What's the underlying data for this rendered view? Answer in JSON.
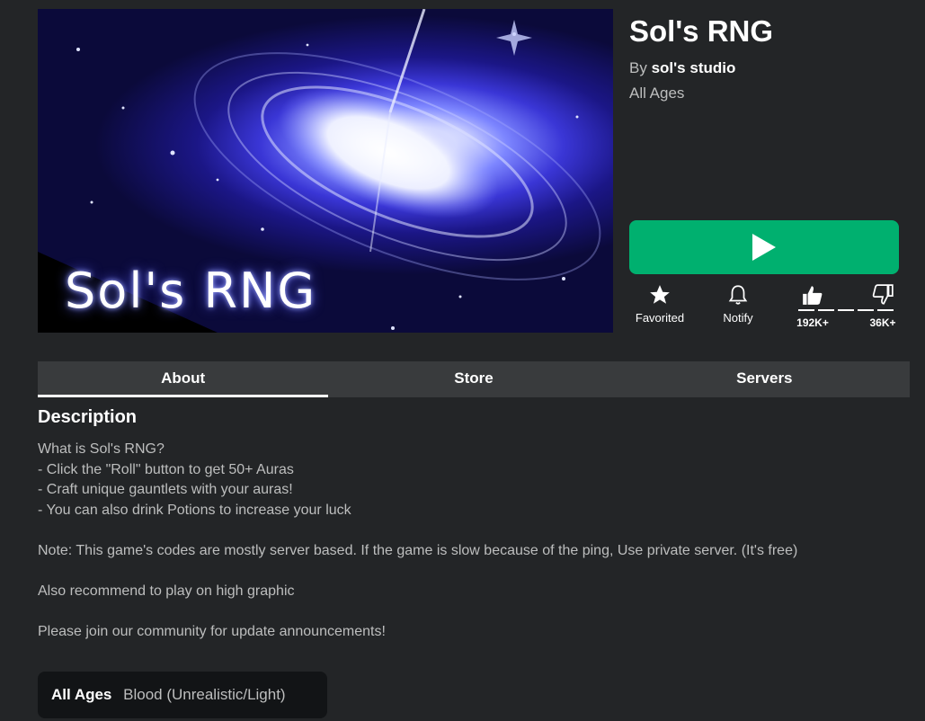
{
  "game": {
    "thumbnail_caption": "Sol's RNG",
    "title": "Sol's RNG",
    "creator_prefix": "By",
    "creator_name": "sol's studio",
    "age_rating": "All Ages"
  },
  "actions": {
    "favorite_label": "Favorited",
    "notify_label": "Notify",
    "upvotes": "192K+",
    "downvotes": "36K+"
  },
  "tabs": [
    "About",
    "Store",
    "Servers"
  ],
  "description": {
    "heading": "Description",
    "lines": [
      "What is Sol's RNG?",
      "- Click the \"Roll\" button to get 50+ Auras",
      "- Craft unique gauntlets with your auras!",
      "- You can also drink Potions to increase your luck",
      "",
      "Note: This game's codes are mostly server based. If the game is slow because of the ping, Use private server. (It's free)",
      "",
      "Also recommend to play on high graphic",
      "",
      "Please join our community for update announcements!"
    ]
  },
  "content_maturity": {
    "label": "All Ages",
    "descriptor": "Blood (Unrealistic/Light)"
  },
  "colors": {
    "background": "#232527",
    "play_button": "#00b06f",
    "tab_bar": "#393b3d",
    "maturity_box": "#121416"
  }
}
